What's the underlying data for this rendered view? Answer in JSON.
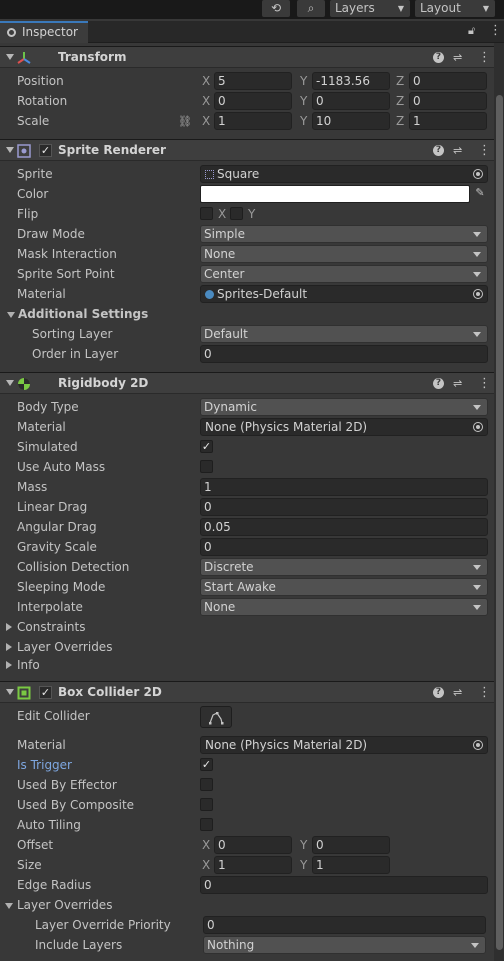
{
  "toolbar": {
    "history_icon": "history-icon",
    "search_icon": "search-icon",
    "layers_label": "Layers",
    "layout_label": "Layout"
  },
  "tab": {
    "label": "Inspector",
    "lock_icon": "lock-icon",
    "menu_icon": "kebab-menu-icon"
  },
  "transform": {
    "title": "Transform",
    "position": {
      "label": "Position",
      "x": "5",
      "y": "-1183.56",
      "z": "0"
    },
    "rotation": {
      "label": "Rotation",
      "x": "0",
      "y": "0",
      "z": "0"
    },
    "scale": {
      "label": "Scale",
      "x": "1",
      "y": "10",
      "z": "1"
    }
  },
  "sprite_renderer": {
    "title": "Sprite Renderer",
    "sprite": {
      "label": "Sprite",
      "value": "Square"
    },
    "color": {
      "label": "Color",
      "value": "#ffffff"
    },
    "flip": {
      "label": "Flip",
      "x": "X",
      "y": "Y"
    },
    "draw_mode": {
      "label": "Draw Mode",
      "value": "Simple"
    },
    "mask_interaction": {
      "label": "Mask Interaction",
      "value": "None"
    },
    "sprite_sort_point": {
      "label": "Sprite Sort Point",
      "value": "Center"
    },
    "material": {
      "label": "Material",
      "value": "Sprites-Default"
    },
    "additional_settings": "Additional Settings",
    "sorting_layer": {
      "label": "Sorting Layer",
      "value": "Default"
    },
    "order_in_layer": {
      "label": "Order in Layer",
      "value": "0"
    }
  },
  "rigidbody": {
    "title": "Rigidbody 2D",
    "body_type": {
      "label": "Body Type",
      "value": "Dynamic"
    },
    "material": {
      "label": "Material",
      "value": "None (Physics Material 2D)"
    },
    "simulated": {
      "label": "Simulated",
      "checked": true
    },
    "use_auto_mass": {
      "label": "Use Auto Mass",
      "checked": false
    },
    "mass": {
      "label": "Mass",
      "value": "1"
    },
    "linear_drag": {
      "label": "Linear Drag",
      "value": "0"
    },
    "angular_drag": {
      "label": "Angular Drag",
      "value": "0.05"
    },
    "gravity_scale": {
      "label": "Gravity Scale",
      "value": "0"
    },
    "collision_detection": {
      "label": "Collision Detection",
      "value": "Discrete"
    },
    "sleeping_mode": {
      "label": "Sleeping Mode",
      "value": "Start Awake"
    },
    "interpolate": {
      "label": "Interpolate",
      "value": "None"
    },
    "constraints": "Constraints",
    "layer_overrides": "Layer Overrides",
    "info": "Info"
  },
  "box_collider": {
    "title": "Box Collider 2D",
    "edit_collider": {
      "label": "Edit Collider"
    },
    "material": {
      "label": "Material",
      "value": "None (Physics Material 2D)"
    },
    "is_trigger": {
      "label": "Is Trigger",
      "checked": true
    },
    "used_by_effector": {
      "label": "Used By Effector",
      "checked": false
    },
    "used_by_composite": {
      "label": "Used By Composite",
      "checked": false
    },
    "auto_tiling": {
      "label": "Auto Tiling",
      "checked": false
    },
    "offset": {
      "label": "Offset",
      "x": "0",
      "y": "0"
    },
    "size": {
      "label": "Size",
      "x": "1",
      "y": "1"
    },
    "edge_radius": {
      "label": "Edge Radius",
      "value": "0"
    },
    "layer_overrides": "Layer Overrides",
    "layer_override_priority": {
      "label": "Layer Override Priority",
      "value": "0"
    },
    "include_layers": {
      "label": "Include Layers",
      "value": "Nothing"
    }
  },
  "axis_labels": {
    "x": "X",
    "y": "Y",
    "z": "Z"
  }
}
